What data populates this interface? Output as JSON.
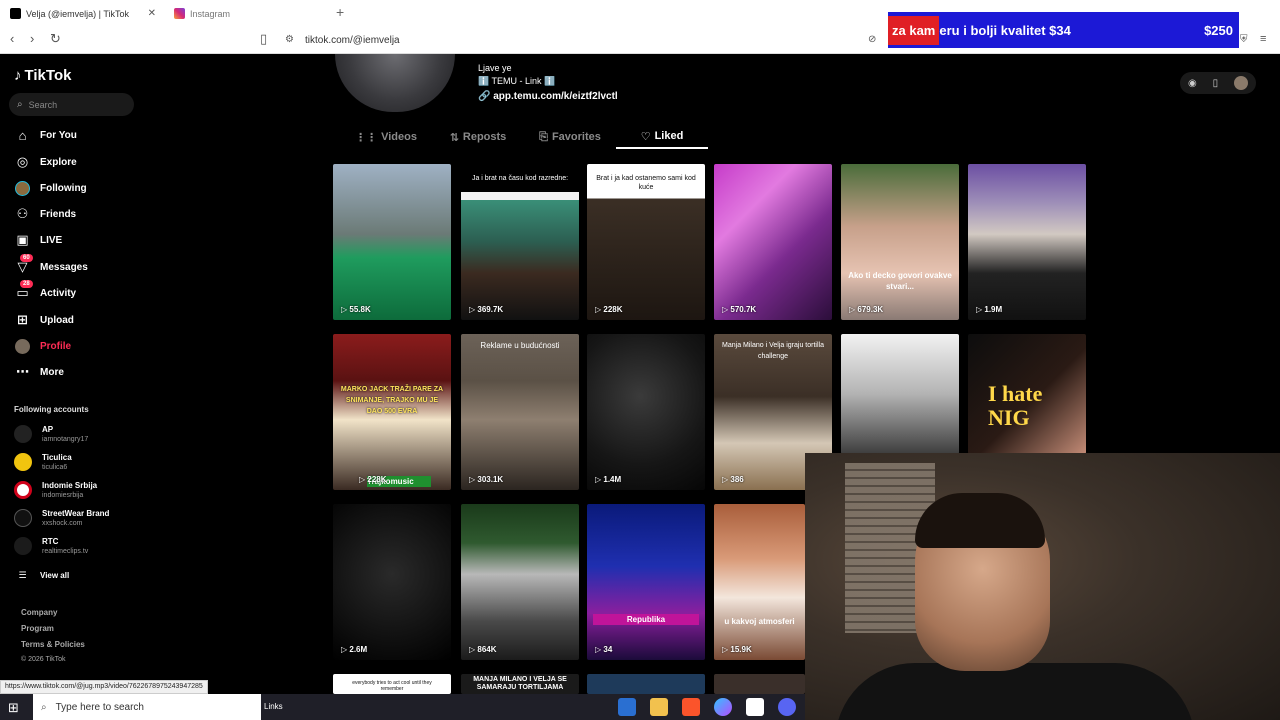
{
  "browser": {
    "tabs": [
      {
        "title": "Velja (@iemvelja) | TikTok",
        "close": "✕"
      },
      {
        "title": "Instagram"
      }
    ],
    "new_tab": "+",
    "url": "tiktok.com/@iemvelja",
    "status_url": "https://www.tiktok.com/@jug.mp3/video/7622678975243947285"
  },
  "ad": {
    "text_red": "za kam",
    "text": "eru i bolji kvalitet $34",
    "price": "$250"
  },
  "sidebar": {
    "logo": "TikTok",
    "search_placeholder": "Search",
    "nav": [
      {
        "label": "For You",
        "icon": "home-icon"
      },
      {
        "label": "Explore",
        "icon": "compass-icon"
      },
      {
        "label": "Following",
        "icon": "avatar-icon"
      },
      {
        "label": "Friends",
        "icon": "friends-icon"
      },
      {
        "label": "LIVE",
        "icon": "live-icon"
      },
      {
        "label": "Messages",
        "icon": "messages-icon",
        "badge": "60"
      },
      {
        "label": "Activity",
        "icon": "activity-icon",
        "badge": "28"
      },
      {
        "label": "Upload",
        "icon": "upload-icon"
      },
      {
        "label": "Profile",
        "icon": "profile-icon"
      },
      {
        "label": "More",
        "icon": "more-icon"
      }
    ],
    "following_title": "Following accounts",
    "accounts": [
      {
        "name": "AP",
        "handle": "iamnotangry17"
      },
      {
        "name": "Ticulica",
        "handle": "ticulica6"
      },
      {
        "name": "Indomie Srbija",
        "handle": "indomiesrbija"
      },
      {
        "name": "StreetWear Brand",
        "handle": "xxshock.com"
      },
      {
        "name": "RTC",
        "handle": "realtimeclips.tv"
      }
    ],
    "view_all": "View all",
    "footer": [
      "Company",
      "Program",
      "Terms & Policies",
      "© 2026 TikTok"
    ]
  },
  "profile": {
    "bio_line1": "Ljave ye",
    "bio_line2": "ℹ️ TEMU - Link ℹ️",
    "link": "app.temu.com/k/eiztf2lvctl",
    "tabs": [
      "Videos",
      "Reposts",
      "Favorites",
      "Liked"
    ]
  },
  "videos": [
    {
      "views": "55.8K"
    },
    {
      "views": "369.7K",
      "caption": "Ja i brat na času kod razredne:"
    },
    {
      "views": "228K",
      "caption": "Brat i ja kad ostanemo sami kod kuće"
    },
    {
      "views": "570.7K"
    },
    {
      "views": "679.3K",
      "overlay": "Ako ti decko govori ovakve stvari..."
    },
    {
      "views": "1.9M"
    },
    {
      "views": "228K",
      "overlay": "MARKO JACK TRAŽI PARE ZA SNIMANJE, TRAJKO MU JE DAO 500 EVRA",
      "sub": "Trajkomusic"
    },
    {
      "views": "303.1K",
      "overlay": "Reklame u budućnosti"
    },
    {
      "views": "1.4M"
    },
    {
      "views": "386",
      "overlay": "Manja Milano i Velja igraju tortilla challenge"
    },
    {
      "views": ""
    },
    {
      "views": "",
      "overlay": "I hate NIG"
    },
    {
      "views": "2.6M"
    },
    {
      "views": "864K"
    },
    {
      "views": "34",
      "overlay": "Republika"
    },
    {
      "views": "15.9K",
      "overlay": "u kakvoj atmosferi"
    },
    {
      "views": "",
      "caption": "everybody tries to act cool until they remember"
    },
    {
      "views": "",
      "overlay": "MANJA MILANO I VELJA SE SAMARAJU TORTILJAMA"
    },
    {
      "views": ""
    },
    {
      "views": ""
    }
  ],
  "taskbar": {
    "search_placeholder": "Type here to search",
    "links": "Links"
  }
}
